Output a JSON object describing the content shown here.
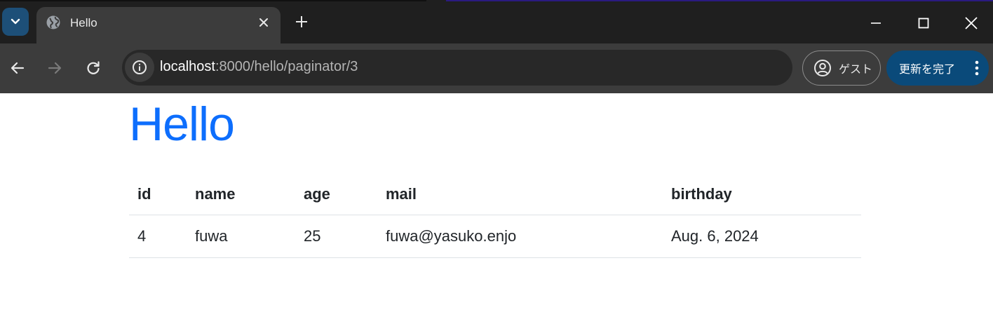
{
  "browser": {
    "tab": {
      "title": "Hello",
      "favicon": "globe-icon"
    },
    "toolbar": {
      "url_host": "localhost",
      "url_rest": ":8000/hello/paginator/3",
      "guest_label": "ゲスト",
      "update_label": "更新を完了"
    },
    "colors": {
      "tabstrip": "#1f1f1f",
      "toolbar": "#3c3c3c",
      "omnibox": "#282828",
      "update_button": "#0a4a7a",
      "accent": "#0d6efd"
    }
  },
  "page": {
    "title": "Hello",
    "table": {
      "headers": [
        "id",
        "name",
        "age",
        "mail",
        "birthday"
      ],
      "rows": [
        [
          "4",
          "fuwa",
          "25",
          "fuwa@yasuko.enjo",
          "Aug. 6, 2024"
        ]
      ]
    }
  }
}
